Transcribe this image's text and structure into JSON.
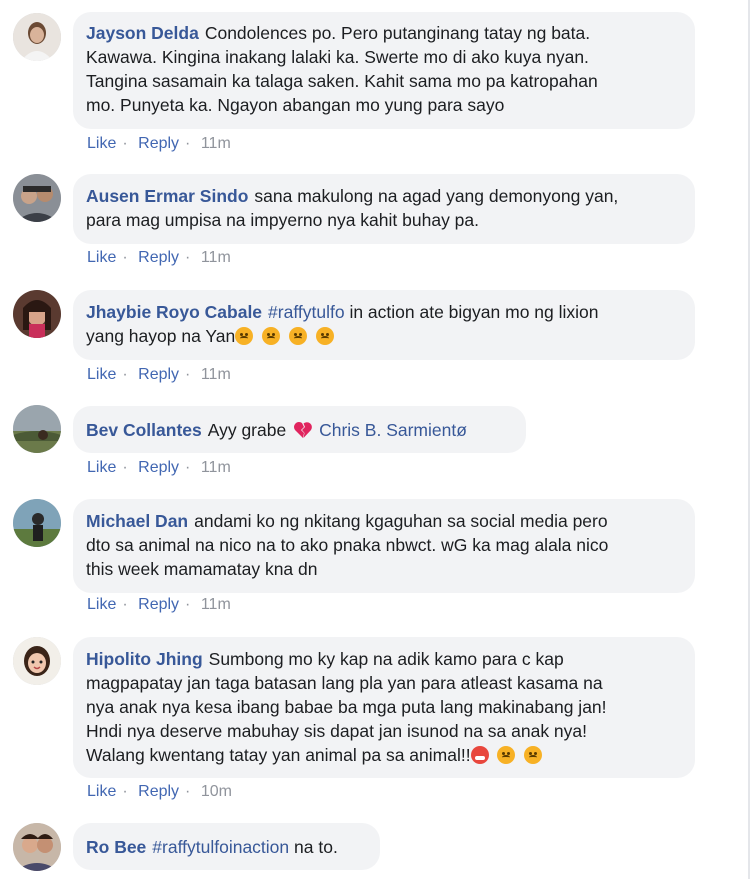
{
  "actions": {
    "like": "Like",
    "reply": "Reply",
    "sep": "·"
  },
  "colors": {
    "link": "#385898",
    "bubble": "#f2f3f5",
    "action": "#4267b2",
    "time": "#90949c"
  },
  "comments": [
    {
      "author": "Jayson Delda",
      "lines": [
        "Condolences po. Pero putanginang tatay ng bata.",
        "Kawawa. Kingina inakang lalaki ka. Swerte mo di ako kuya nyan.",
        "Tangina sasamain ka talaga saken. Kahit sama mo pa katropahan",
        "mo. Punyeta ka. Ngayon abangan mo yung para sayo"
      ],
      "time": "11m"
    },
    {
      "author": "Ausen Ermar Sindo",
      "lines": [
        "sana makulong na agad yang demonyong yan,",
        "para mag umpisa na impyerno nya kahit buhay pa."
      ],
      "time": "11m"
    },
    {
      "author": "Jhaybie Royo Cabale",
      "hashtag": "#raffytulfo",
      "lines": [
        "in action ate bigyan mo ng lixion",
        "yang hayop na Yan"
      ],
      "emojis": [
        "angry-face-emoji",
        "angry-face-emoji",
        "angry-face-emoji",
        "angry-face-emoji"
      ],
      "time": "11m"
    },
    {
      "author": "Bev Collantes",
      "lines": [
        "Ayy grabe"
      ],
      "emoji": "broken-heart-emoji",
      "mention": "Chris B. Sarmientø",
      "time": "11m"
    },
    {
      "author": "Michael Dan",
      "lines": [
        "andami ko ng nkitang kgaguhan sa social media pero",
        "dto sa animal na nico na to ako pnaka nbwct. wG ka mag alala nico",
        "this week mamamatay kna dn"
      ],
      "time": "11m"
    },
    {
      "author": "Hipolito Jhing",
      "lines": [
        "Sumbong mo ky kap na adik kamo para c kap",
        "magpapatay jan taga batasan lang pla yan para atleast kasama na",
        "nya anak nya kesa ibang babae ba mga puta lang makinabang jan!",
        "Hndi nya deserve mabuhay sis dapat jan isunod na sa anak nya!",
        "Walang kwentang tatay yan animal pa sa animal!!"
      ],
      "emojis": [
        "swearing-face-emoji",
        "angry-face-emoji",
        "angry-face-emoji"
      ],
      "time": "10m"
    },
    {
      "author": "Ro Bee",
      "hashtag": "#raffytulfoinaction",
      "lines": [
        "na to."
      ]
    }
  ]
}
